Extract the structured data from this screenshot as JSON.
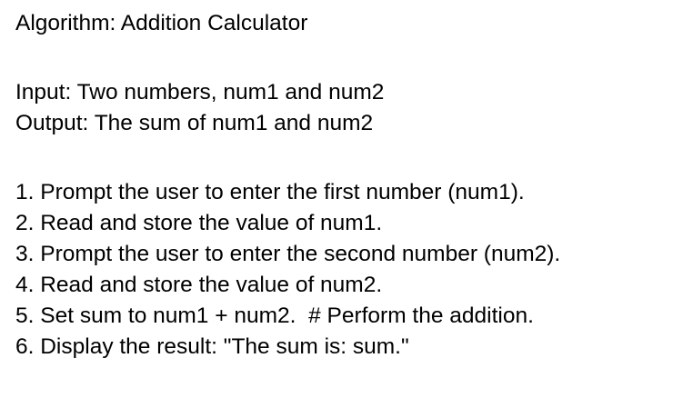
{
  "title": "Algorithm: Addition Calculator",
  "input": "Input: Two numbers, num1 and num2",
  "output": "Output: The sum of num1 and num2",
  "steps": [
    "1. Prompt the user to enter the first number (num1).",
    "2. Read and store the value of num1.",
    "3. Prompt the user to enter the second number (num2).",
    "4. Read and store the value of num2.",
    "5. Set sum to num1 + num2.  # Perform the addition.",
    "6. Display the result: \"The sum is: sum.\""
  ]
}
